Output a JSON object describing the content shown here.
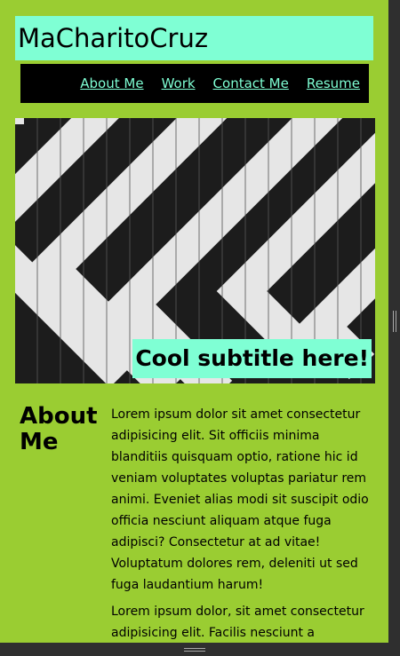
{
  "site": {
    "title": "MaCharitoCruz"
  },
  "nav": {
    "items": [
      {
        "label": "About Me"
      },
      {
        "label": "Work"
      },
      {
        "label": "Contact Me"
      },
      {
        "label": "Resume"
      }
    ]
  },
  "hero": {
    "caption": "Cool subtitle here!"
  },
  "about": {
    "heading_line1": "About",
    "heading_line2": "Me",
    "paragraphs": [
      "Lorem ipsum dolor sit amet consectetur adipisicing elit. Sit officiis minima blanditiis quisquam optio, ratione hic id veniam voluptates voluptas pariatur rem animi. Eveniet alias modi sit suscipit odio officia nesciunt aliquam atque fuga adipisci? Consectetur at ad vitae! Voluptatum dolores rem, deleniti ut sed fuga laudantium harum!",
      "Lorem ipsum dolor, sit amet consectetur adipisicing elit. Facilis nesciunt a"
    ]
  },
  "colors": {
    "page_background": "#9acd32",
    "accent": "#7fffd4",
    "nav_background": "#000000",
    "chrome": "#2f2f2f"
  }
}
